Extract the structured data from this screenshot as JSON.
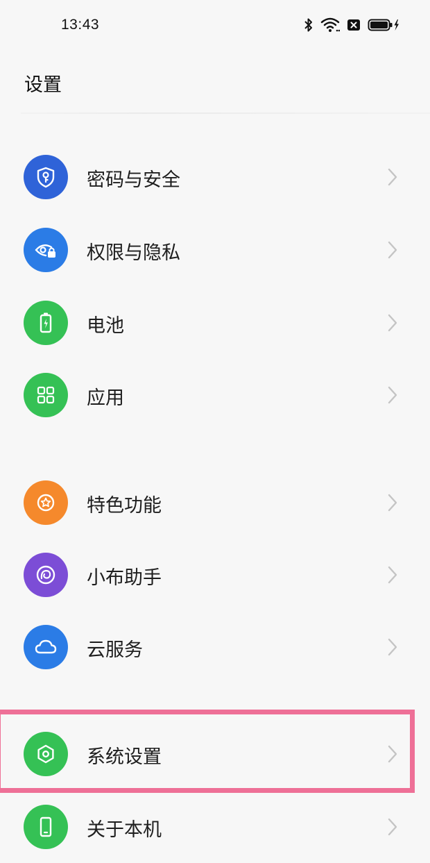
{
  "status": {
    "time": "13:43"
  },
  "header": {
    "title": "设置"
  },
  "items": [
    {
      "label": "密码与安全",
      "icon": "shield-key-icon",
      "color": "#2f63d8"
    },
    {
      "label": "权限与隐私",
      "icon": "eye-lock-icon",
      "color": "#2b7ce6"
    },
    {
      "label": "电池",
      "icon": "battery-icon",
      "color": "#35c155"
    },
    {
      "label": "应用",
      "icon": "apps-grid-icon",
      "color": "#35c155"
    },
    {
      "label": "特色功能",
      "icon": "star-icon",
      "color": "#f5892c"
    },
    {
      "label": "小布助手",
      "icon": "assistant-icon",
      "color": "#7c4dd6"
    },
    {
      "label": "云服务",
      "icon": "cloud-icon",
      "color": "#2b7ce6"
    },
    {
      "label": "系统设置",
      "icon": "gear-hexagon-icon",
      "color": "#35c155"
    },
    {
      "label": "关于本机",
      "icon": "phone-icon",
      "color": "#35c155"
    }
  ],
  "colors": {
    "highlight": "#ee7097",
    "chevron": "#c4c4c4",
    "background": "#f7f7f7"
  }
}
